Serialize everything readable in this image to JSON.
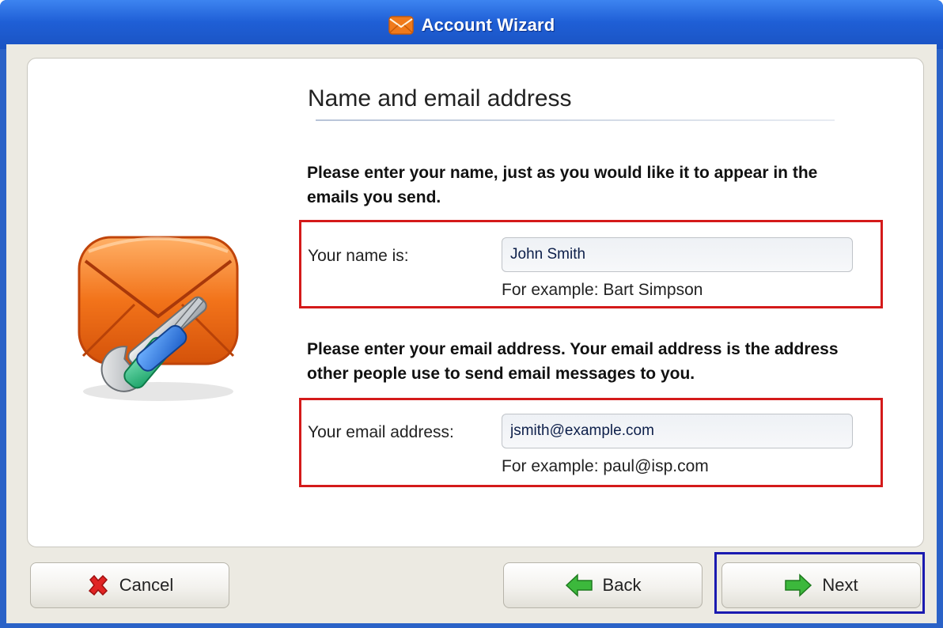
{
  "window": {
    "title": "Account Wizard",
    "title_icon": "envelope-icon"
  },
  "page": {
    "heading": "Name and email address",
    "name_instruction": "Please enter your name, just as you would like it to appear in the emails you send.",
    "email_instruction": "Please enter your email address. Your email address is the address other people use to send email messages to you."
  },
  "name_field": {
    "label": "Your name is:",
    "value": "John Smith",
    "example": "For example: Bart Simpson"
  },
  "email_field": {
    "label": "Your email address:",
    "value": "jsmith@example.com",
    "example": "For example: paul@isp.com"
  },
  "buttons": {
    "cancel": {
      "label": "Cancel",
      "icon": "red-x-icon"
    },
    "back": {
      "label": "Back",
      "icon": "green-left-arrow-icon"
    },
    "next": {
      "label": "Next",
      "icon": "green-right-arrow-icon"
    }
  },
  "colors": {
    "titlebar": "#1f5fd6",
    "highlight_red": "#d41a1a",
    "highlight_blue": "#1a1ab0",
    "arrow_green": "#3cb83c"
  }
}
